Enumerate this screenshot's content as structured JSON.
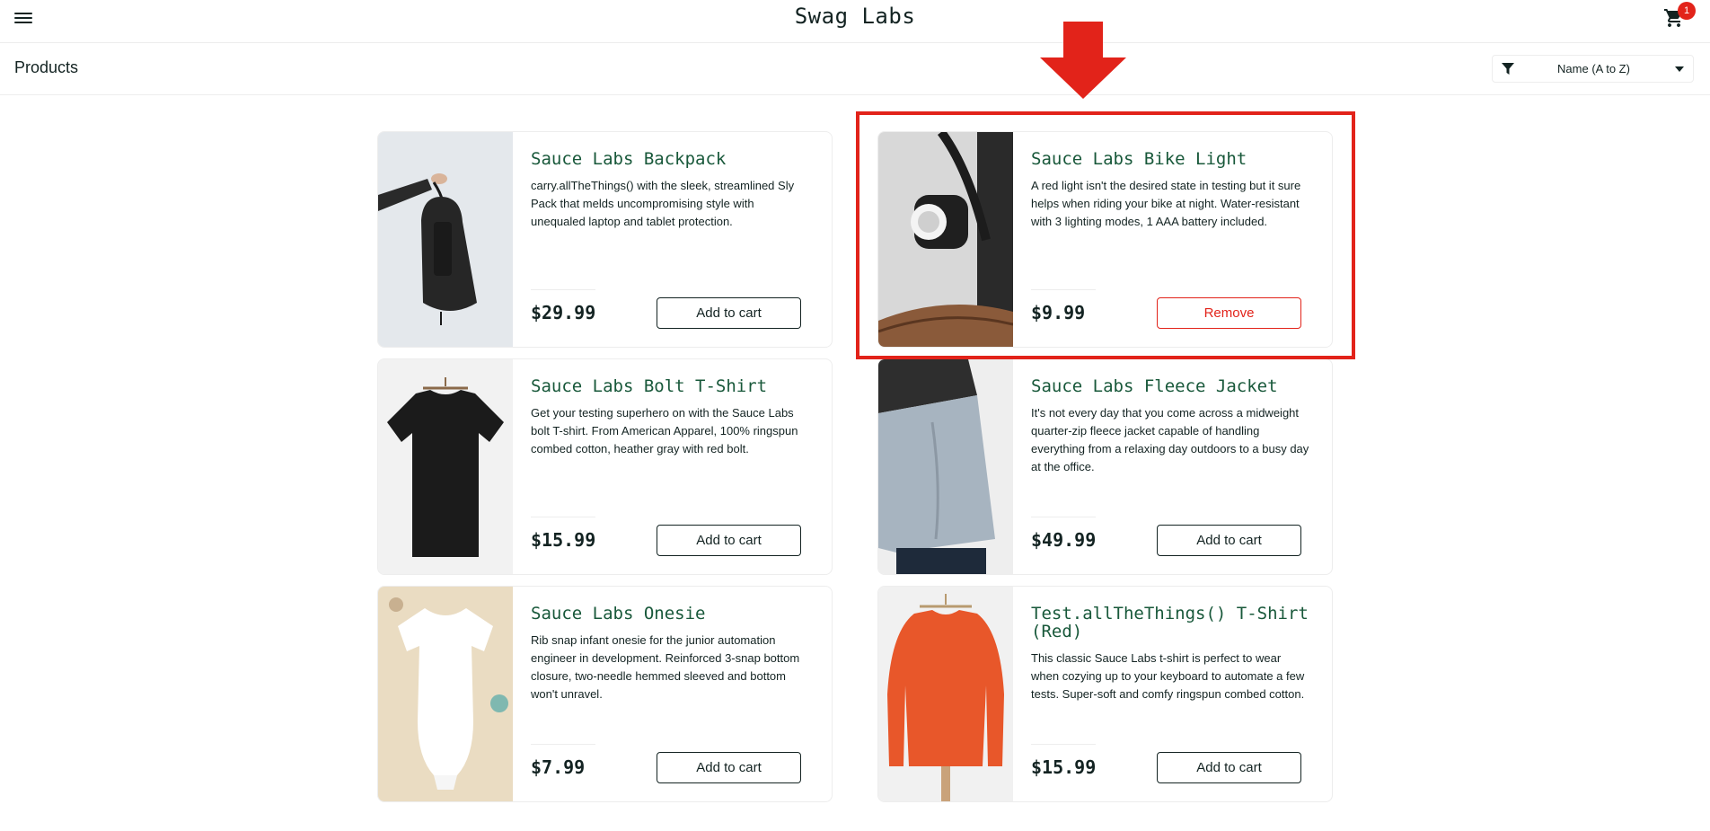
{
  "header": {
    "logo": "Swag Labs",
    "cart_count": "1"
  },
  "subheader": {
    "title": "Products",
    "sort": {
      "selected": "Name (A to Z)"
    }
  },
  "colors": {
    "accent": "#e2231a",
    "title_green": "#18583a",
    "text": "#132322"
  },
  "icons": [
    "menu-icon",
    "shopping-cart-icon",
    "filter-icon",
    "chevron-down-icon",
    "arrow-down-icon"
  ],
  "items": [
    {
      "name": "Sauce Labs Backpack",
      "description": "carry.allTheThings() with the sleek, streamlined Sly Pack that melds uncompromising style with unequaled laptop and tablet protection.",
      "price": "$29.99",
      "button": "Add to cart"
    },
    {
      "name": "Sauce Labs Bike Light",
      "description": "A red light isn't the desired state in testing but it sure helps when riding your bike at night. Water-resistant with 3 lighting modes, 1 AAA battery included.",
      "price": "$9.99",
      "button": "Remove"
    },
    {
      "name": "Sauce Labs Bolt T-Shirt",
      "description": "Get your testing superhero on with the Sauce Labs bolt T-shirt. From American Apparel, 100% ringspun combed cotton, heather gray with red bolt.",
      "price": "$15.99",
      "button": "Add to cart"
    },
    {
      "name": "Sauce Labs Fleece Jacket",
      "description": "It's not every day that you come across a midweight quarter-zip fleece jacket capable of handling everything from a relaxing day outdoors to a busy day at the office.",
      "price": "$49.99",
      "button": "Add to cart"
    },
    {
      "name": "Sauce Labs Onesie",
      "description": "Rib snap infant onesie for the junior automation engineer in development. Reinforced 3-snap bottom closure, two-needle hemmed sleeved and bottom won't unravel.",
      "price": "$7.99",
      "button": "Add to cart"
    },
    {
      "name": "Test.allTheThings() T-Shirt (Red)",
      "description": "This classic Sauce Labs t-shirt is perfect to wear when cozying up to your keyboard to automate a few tests. Super-soft and comfy ringspun combed cotton.",
      "price": "$15.99",
      "button": "Add to cart"
    }
  ]
}
